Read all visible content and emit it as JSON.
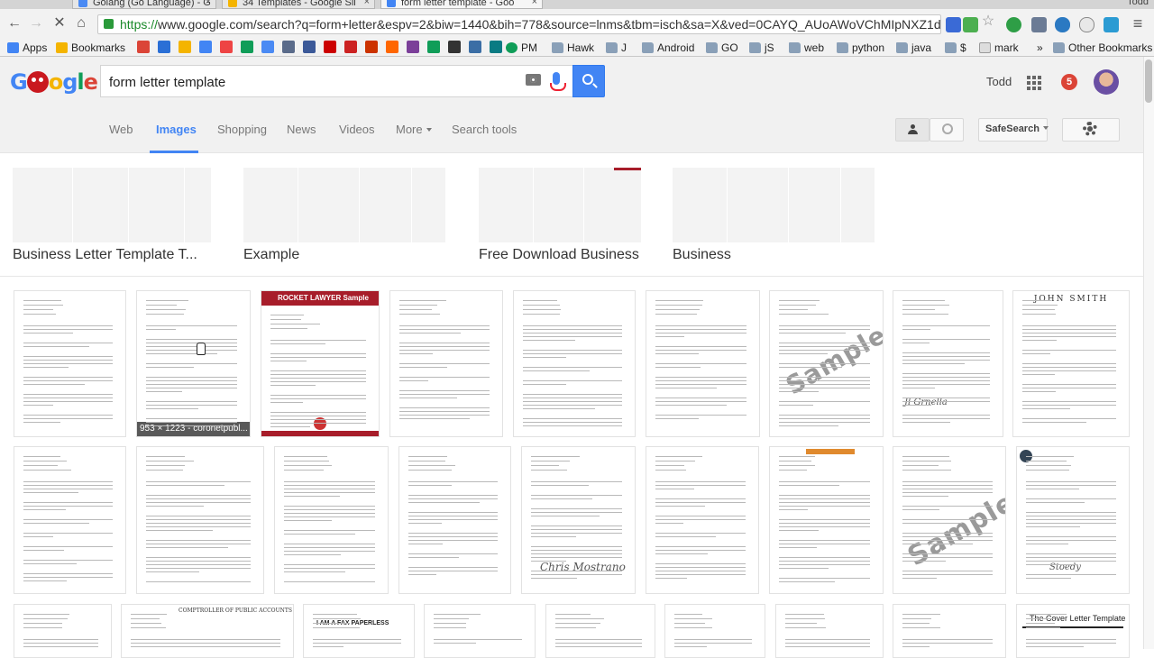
{
  "browser": {
    "tabs": [
      {
        "title": "Golang (Go Language) - G",
        "active": false,
        "fav_color": "#4a8af4"
      },
      {
        "title": "34 Templates - Google Sli",
        "active": false,
        "fav_color": "#f4b400"
      },
      {
        "title": "form letter template - Goo",
        "active": true,
        "fav_color": "#4285f4"
      }
    ],
    "user_corner": "Todd",
    "url_scheme": "https://",
    "url_rest": "www.google.com/search?q=form+letter&espv=2&biw=1440&bih=778&source=lnms&tbm=isch&sa=X&ved=0CAYQ_AUoAWoVChMIpNXZ1d-byAIVi...",
    "bookmarks": [
      {
        "label": "Apps",
        "kind": "apps"
      },
      {
        "label": "Bookmarks",
        "kind": "star"
      },
      {
        "label": "Hawk",
        "kind": "folder"
      },
      {
        "label": "J",
        "kind": "folder"
      },
      {
        "label": "Android",
        "kind": "folder"
      },
      {
        "label": "GO",
        "kind": "folder"
      },
      {
        "label": "jS",
        "kind": "folder"
      },
      {
        "label": "web",
        "kind": "folder"
      },
      {
        "label": "python",
        "kind": "folder"
      },
      {
        "label": "java",
        "kind": "folder"
      },
      {
        "label": "$",
        "kind": "folder"
      },
      {
        "label": "mark",
        "kind": "page"
      },
      {
        "label": "PM",
        "kind": "page"
      },
      {
        "label": "»",
        "kind": "more"
      },
      {
        "label": "Other Bookmarks",
        "kind": "folder"
      }
    ],
    "bookmark_icon_colors": [
      "#db4437",
      "#2a6fd6",
      "#f4b400",
      "#4285f4",
      "#e44",
      "#0f9d58",
      "#4a8af4",
      "#5a6b8a",
      "#3b5998",
      "#cc0000",
      "#cc2222",
      "#cc3300",
      "#ff6600",
      "#7b3f99",
      "#0f9d58",
      "#333333",
      "#3b6ea5",
      "#0a7b83"
    ]
  },
  "google": {
    "query": "form letter template",
    "username": "Todd",
    "notifications": "5",
    "nav_tabs": [
      {
        "label": "Web",
        "active": false
      },
      {
        "label": "Images",
        "active": true
      },
      {
        "label": "Shopping",
        "active": false
      },
      {
        "label": "News",
        "active": false
      },
      {
        "label": "Videos",
        "active": false
      },
      {
        "label": "More",
        "active": false
      },
      {
        "label": "Search tools",
        "active": false
      }
    ],
    "safesearch_label": "SafeSearch"
  },
  "related_searches": [
    {
      "label": "Business Letter Template T..."
    },
    {
      "label": "Example"
    },
    {
      "label": "Free Download Business"
    },
    {
      "label": "Business"
    }
  ],
  "results": {
    "hover_caption": "953 × 1223 - coronetpubl...",
    "rocketlawyer_label": "ROCKET LAWYER  Sample",
    "sample_watermark": "Sample",
    "john_smith_header": "JOHN SMITH",
    "cover_letter_title": "The Cover Letter Template",
    "comptroller_header": "COMPTROLLER OF PUBLIC ACCOUNTS",
    "paperless_label": "I AM A FAX  PAPERLESS"
  }
}
